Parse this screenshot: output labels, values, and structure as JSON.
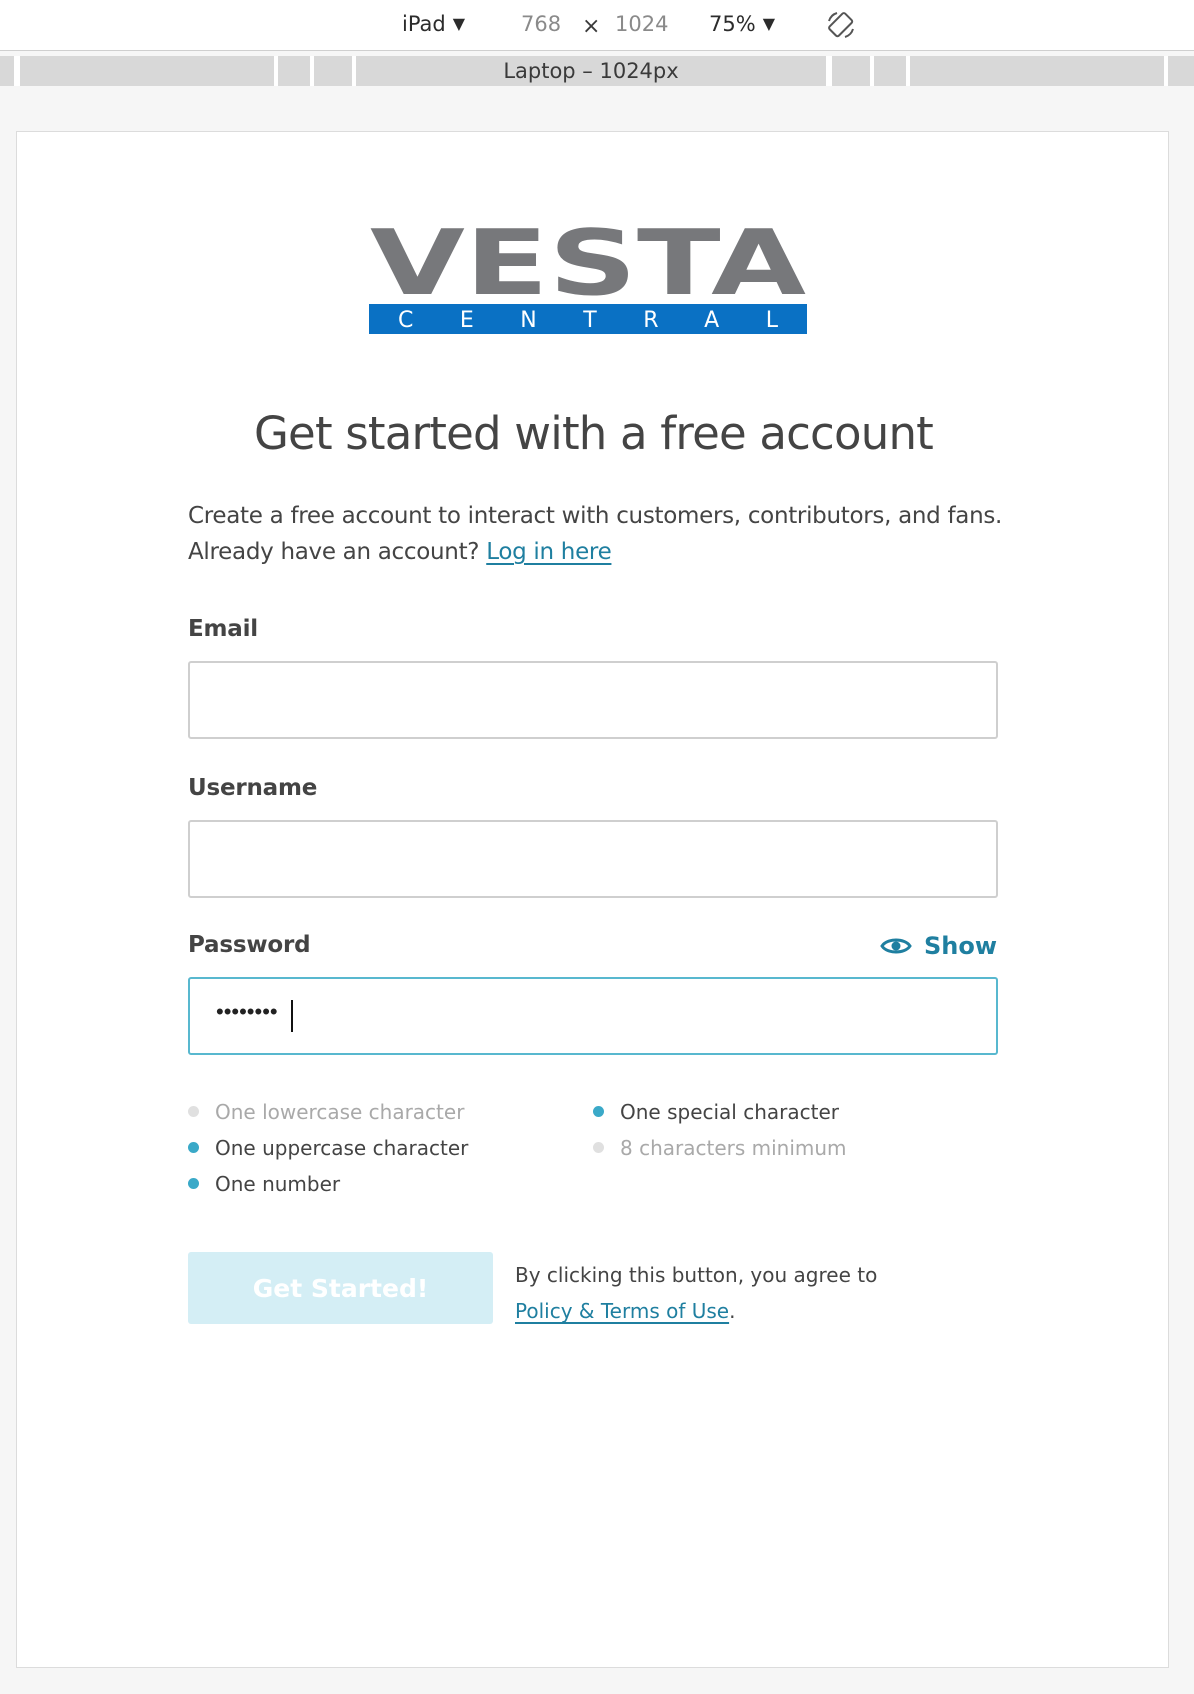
{
  "devtools": {
    "device": "iPad",
    "width": "768",
    "times": "×",
    "height": "1024",
    "zoom": "75%",
    "ruler_label": "Laptop – 1024px"
  },
  "brand": {
    "logo_top": "VESTA",
    "logo_bottom": "CENTRAL",
    "logo_color_gray": "#77787b",
    "logo_color_blue": "#0a71c4"
  },
  "page": {
    "title": "Get started with a free account",
    "intro_line1": "Create a free account to interact with customers, contributors, and fans.",
    "intro_line2": "Already have an account?",
    "login_link": "Log in here"
  },
  "form": {
    "email_label": "Email",
    "email_value": "",
    "username_label": "Username",
    "username_value": "",
    "password_label": "Password",
    "password_masked": "••••••••",
    "show_label": "Show"
  },
  "requirements": [
    {
      "label": "One lowercase character",
      "met": false
    },
    {
      "label": "One uppercase character",
      "met": true
    },
    {
      "label": "One number",
      "met": true
    },
    {
      "label": "One special character",
      "met": true
    },
    {
      "label": "8 characters minimum",
      "met": false
    }
  ],
  "submit": {
    "label": "Get Started!",
    "agree_text": "By clicking this button, you agree to",
    "policy_link": "Policy & Terms of Use",
    "period": "."
  },
  "colors": {
    "accent": "#1f7fa0",
    "focus_border": "#58b8cf",
    "requirement_met": "#3aa9c8",
    "button_disabled": "#d4eef5"
  }
}
